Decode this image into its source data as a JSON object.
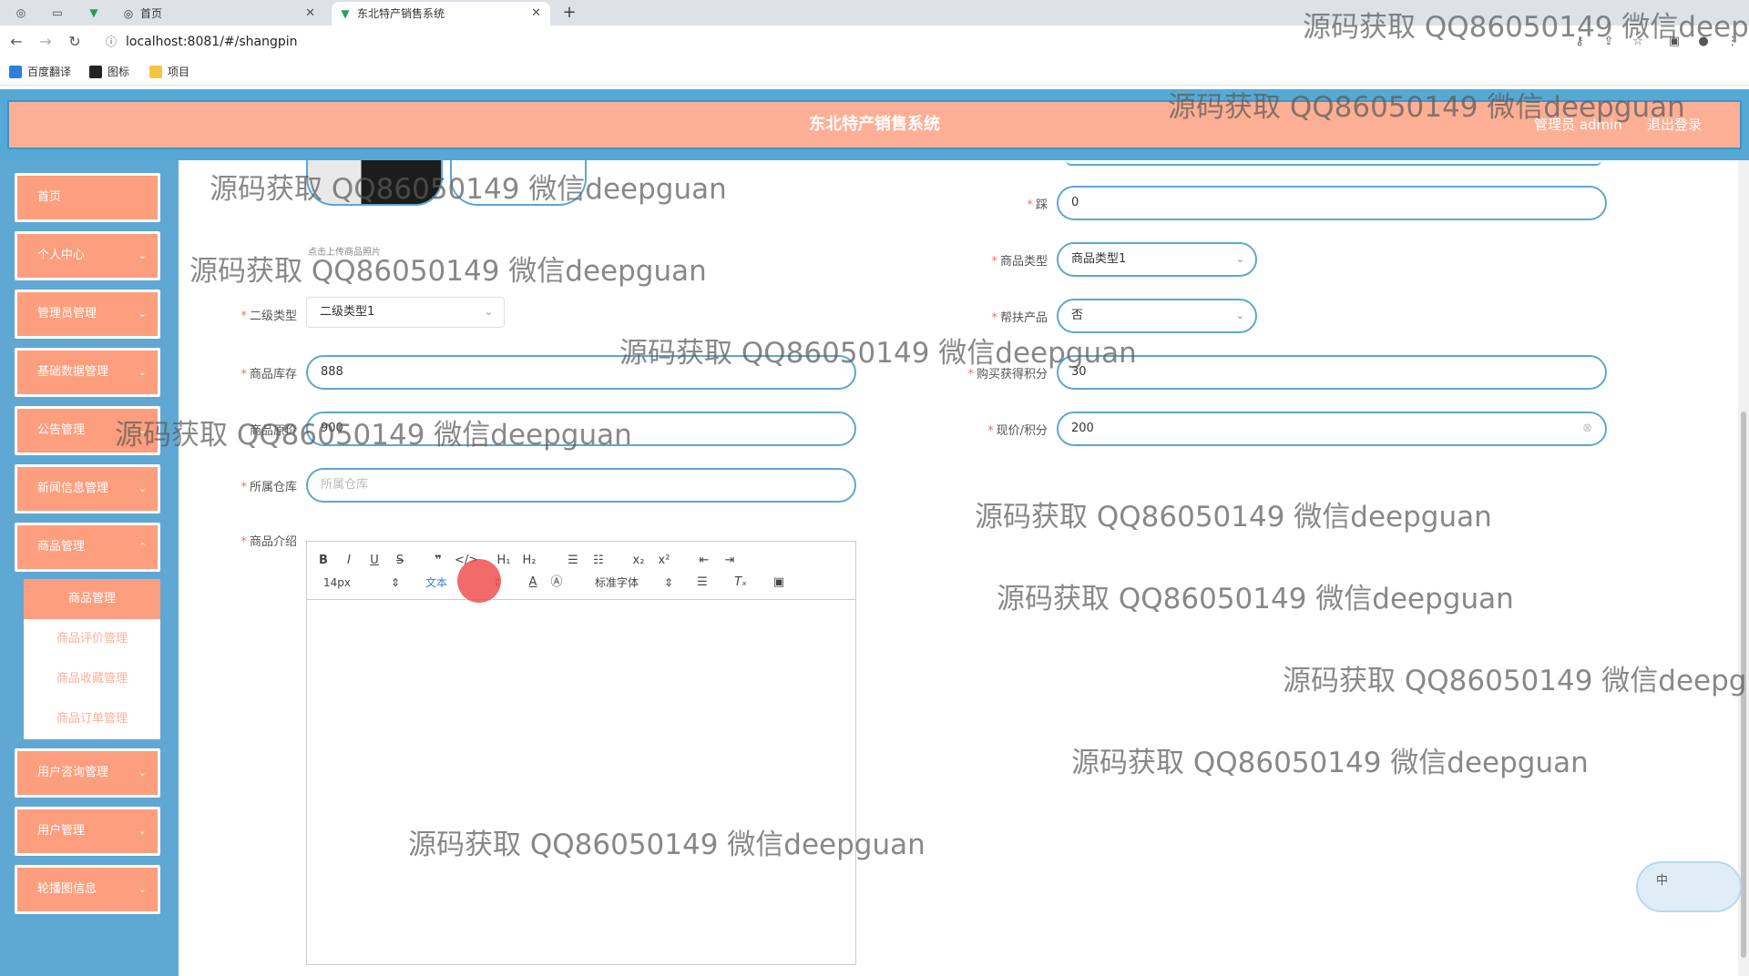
{
  "browser": {
    "tabs": [
      {
        "label": "首页",
        "icon": "globe-icon"
      },
      {
        "label": "东北特产销售系统",
        "icon": "vue-icon"
      }
    ],
    "url": "localhost:8081/#/shangpin",
    "bookmarks": [
      "百度翻译",
      "图标",
      "项目"
    ]
  },
  "header": {
    "title": "东北特产销售系统",
    "admin": "管理员 admin",
    "logout": "退出登录"
  },
  "sidebar": {
    "items": [
      {
        "label": "首页"
      },
      {
        "label": "个人中心"
      },
      {
        "label": "管理员管理"
      },
      {
        "label": "基础数据管理"
      },
      {
        "label": "公告管理"
      },
      {
        "label": "新闻信息管理"
      },
      {
        "label": "商品管理"
      },
      {
        "label": "用户咨询管理"
      },
      {
        "label": "用户管理"
      },
      {
        "label": "轮播图信息"
      }
    ],
    "submenu": [
      "商品管理",
      "商品评价管理",
      "商品收藏管理",
      "商品订单管理"
    ]
  },
  "form": {
    "upload_hint": "点击上传商品照片",
    "secondary_type": {
      "label": "二级类型",
      "value": "二级类型1"
    },
    "stock": {
      "label": "商品库存",
      "value": "888"
    },
    "price_label": "商品原价",
    "price_value": "900",
    "warehouse": {
      "label": "所属仓库",
      "placeholder": "所属仓库"
    },
    "intro_label": "商品介绍",
    "right_first": {
      "label": "踩",
      "value": "0"
    },
    "product_type": {
      "label": "商品类型",
      "value": "商品类型1"
    },
    "aid_product": {
      "label": "帮扶产品",
      "value": "否"
    },
    "points": {
      "label": "购买获得积分",
      "value": "30"
    },
    "current_price": {
      "label": "现价/积分",
      "value": "200"
    }
  },
  "editor": {
    "font_size": "14px",
    "text_style": "文本",
    "font_family": "标准字体"
  },
  "ime": {
    "label": "中"
  },
  "watermark": "源码获取 QQ86050149 微信deepguan",
  "watermark_cut": "源码获取 QQ86050149 微信deepgu",
  "watermark_cut2": "源码获取 QQ86050149 微信deepgua"
}
